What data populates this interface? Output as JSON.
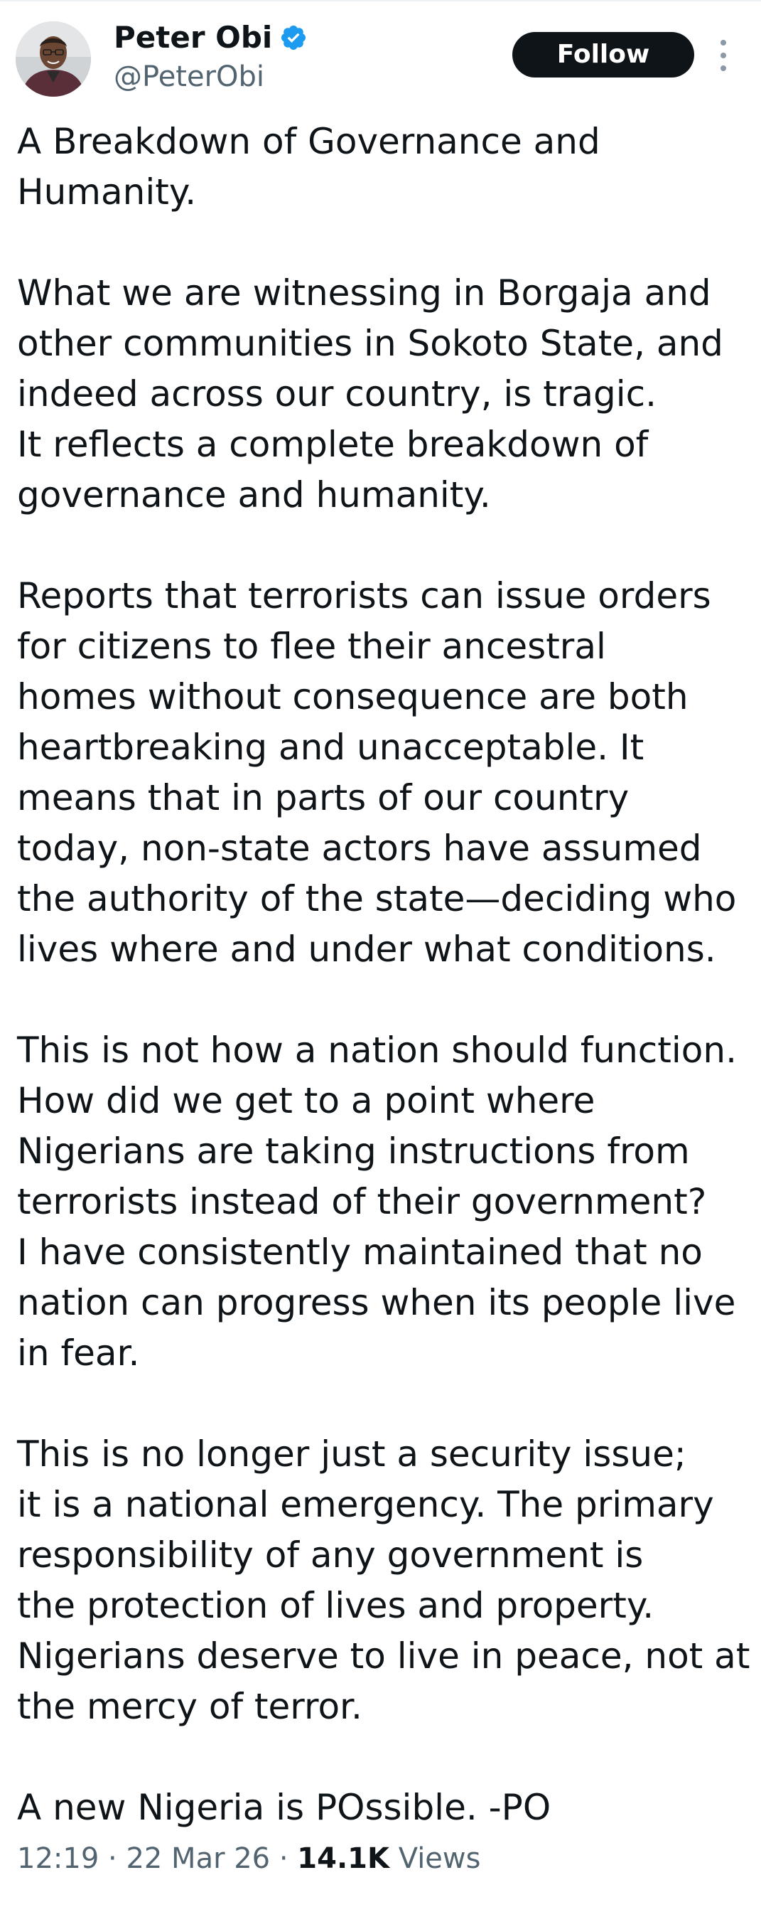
{
  "author": {
    "display_name": "Peter Obi",
    "handle": "@PeterObi",
    "verified_color": "#1d9bf0"
  },
  "actions": {
    "follow_label": "Follow",
    "more_icon": "more-vertical-icon"
  },
  "tweet": {
    "paragraphs": [
      "A Breakdown of Governance and\nHumanity.",
      "What we are witnessing in Borgaja and\nother communities in Sokoto State, and\nindeed across our country, is tragic.\nIt reflects a complete breakdown of\ngovernance and humanity.",
      "Reports that terrorists can issue orders\nfor citizens to flee their ancestral\nhomes without consequence are both\nheartbreaking and unacceptable. It\nmeans that in parts of our country\ntoday, non-state actors have assumed\nthe authority of the state—deciding who\nlives where and under what conditions.",
      "This is not how a nation should function.\nHow did we get to a point where\nNigerians are taking instructions from\nterrorists instead of their government?\nI have consistently maintained that no\nnation can progress when its people live\nin fear.",
      "This is no longer just a security issue;\nit is a national emergency. The primary\nresponsibility of any government is\nthe protection of lives and property.\nNigerians deserve to live in peace, not at\nthe mercy of terror.",
      "A new Nigeria is POssible. -PO"
    ]
  },
  "meta": {
    "time": "12:19",
    "separator": " · ",
    "date": "22 Mar 26",
    "views_count": "14.1K",
    "views_label": "Views"
  }
}
